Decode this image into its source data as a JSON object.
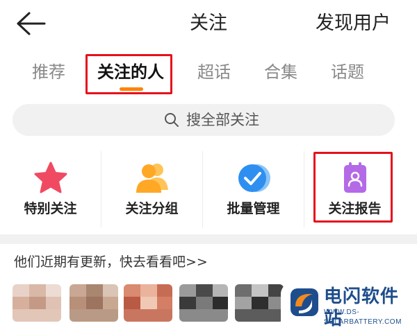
{
  "header": {
    "back_icon": "arrow-left-icon",
    "title": "关注",
    "right_action": "发现用户"
  },
  "tabs": [
    {
      "label": "推荐",
      "active": false
    },
    {
      "label": "关注的人",
      "active": true
    },
    {
      "label": "超话",
      "active": false
    },
    {
      "label": "合集",
      "active": false
    },
    {
      "label": "话题",
      "active": false
    }
  ],
  "search": {
    "icon": "search-icon",
    "text": "搜全部关注"
  },
  "grid": [
    {
      "label": "特别关注",
      "icon": "star-icon",
      "color": "#f04a62"
    },
    {
      "label": "关注分组",
      "icon": "group-users-icon",
      "color": "#ffa826"
    },
    {
      "label": "批量管理",
      "icon": "check-circle-icon",
      "color": "#2e8ff0"
    },
    {
      "label": "关注报告",
      "icon": "report-clipboard-icon",
      "color": "#b469e6"
    }
  ],
  "updates": {
    "text": "他们近期有更新，快去看看吧>>"
  },
  "watermark": {
    "name": "电闪软件站",
    "url": "WWW.DS-SOLARBATTERY.COM"
  },
  "colors": {
    "accent": "#ff8200",
    "highlight_box": "#e5101c",
    "watermark": "#1e4d8c"
  }
}
